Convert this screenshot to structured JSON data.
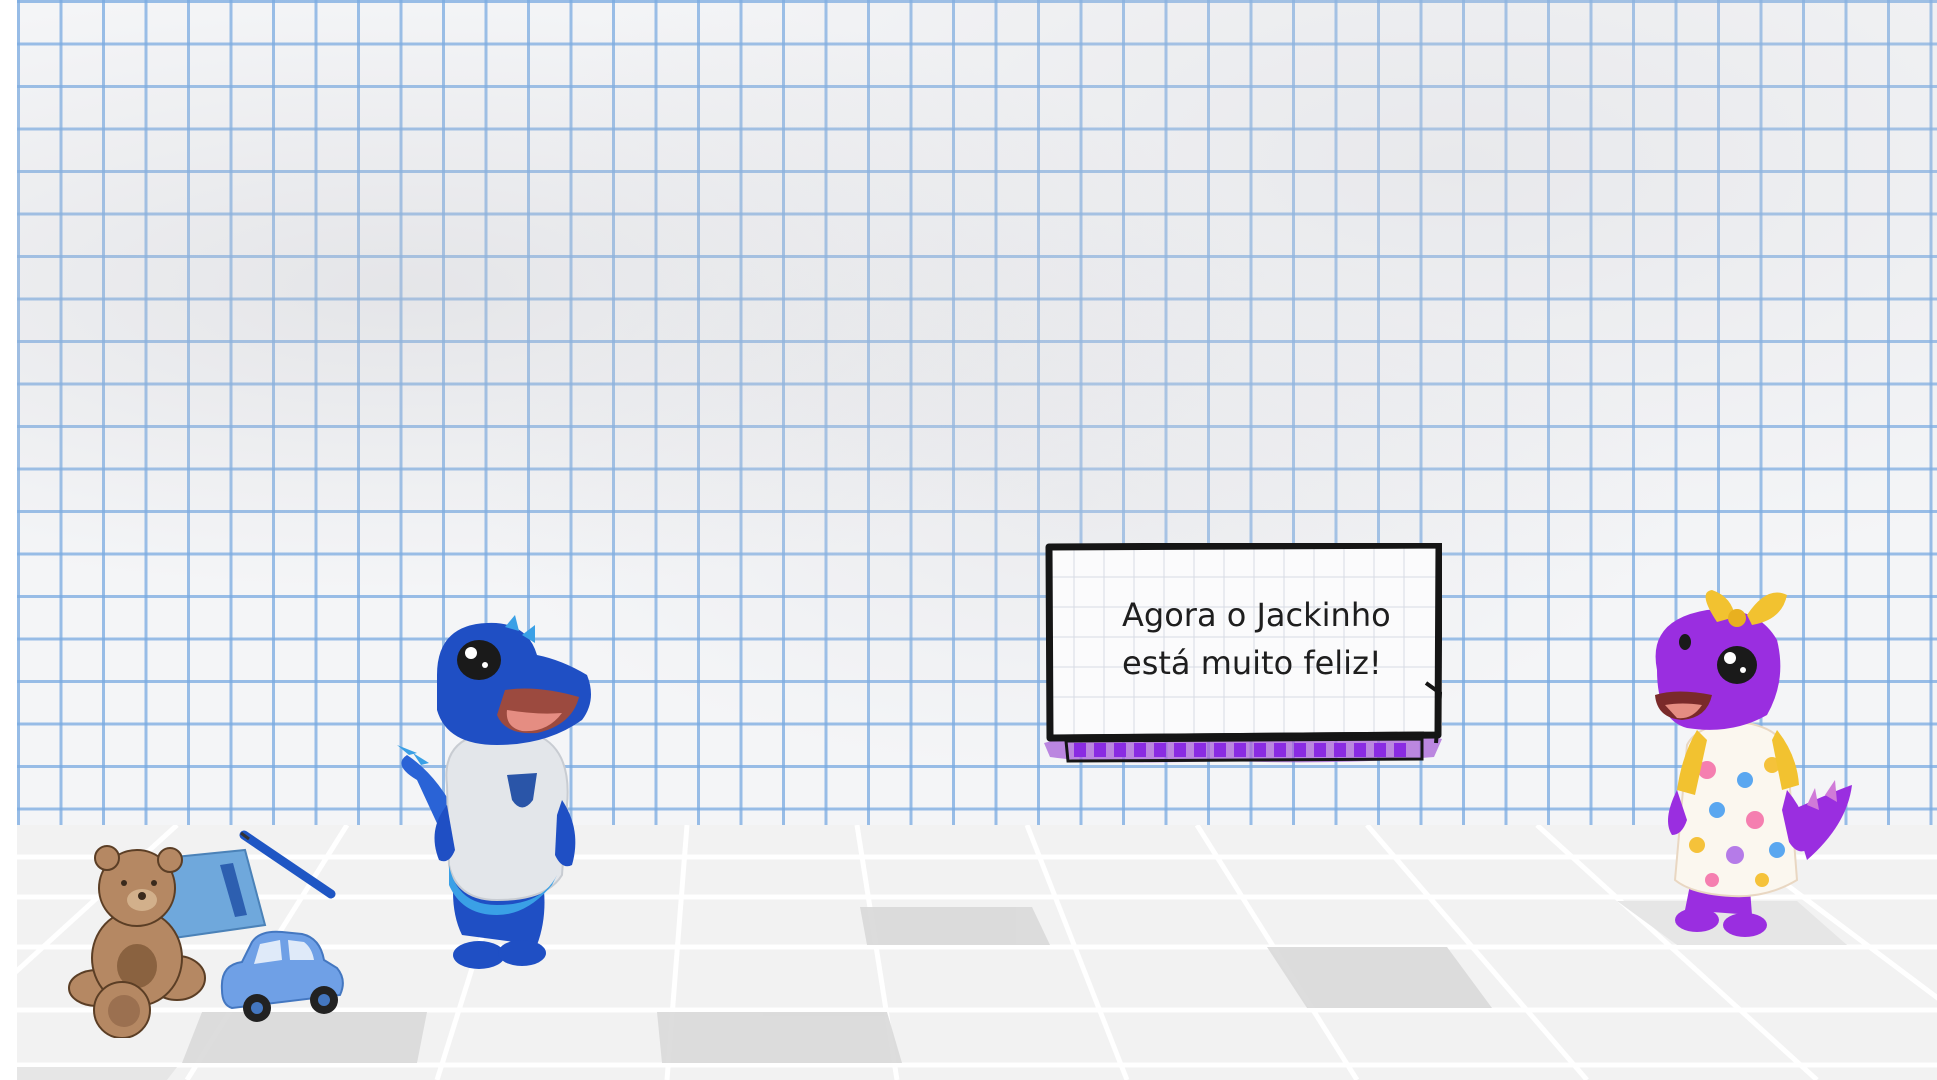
{
  "dialogue": {
    "text": "Agora o Jackinho\nestá muito feliz!"
  },
  "characters": {
    "blue_dino": "blue-dinosaur",
    "purple_dino": "purple-dinosaur"
  },
  "props": {
    "teddy": "teddy-bear",
    "car": "toy-car",
    "notebook": "notebook",
    "pencil": "pencil"
  },
  "colors": {
    "grid_line": "#7aaae1",
    "blue_dino": "#1f4fc4",
    "purple_dino": "#9a2ee0",
    "accent_purple": "#8a2be2",
    "bow": "#f2c230"
  }
}
